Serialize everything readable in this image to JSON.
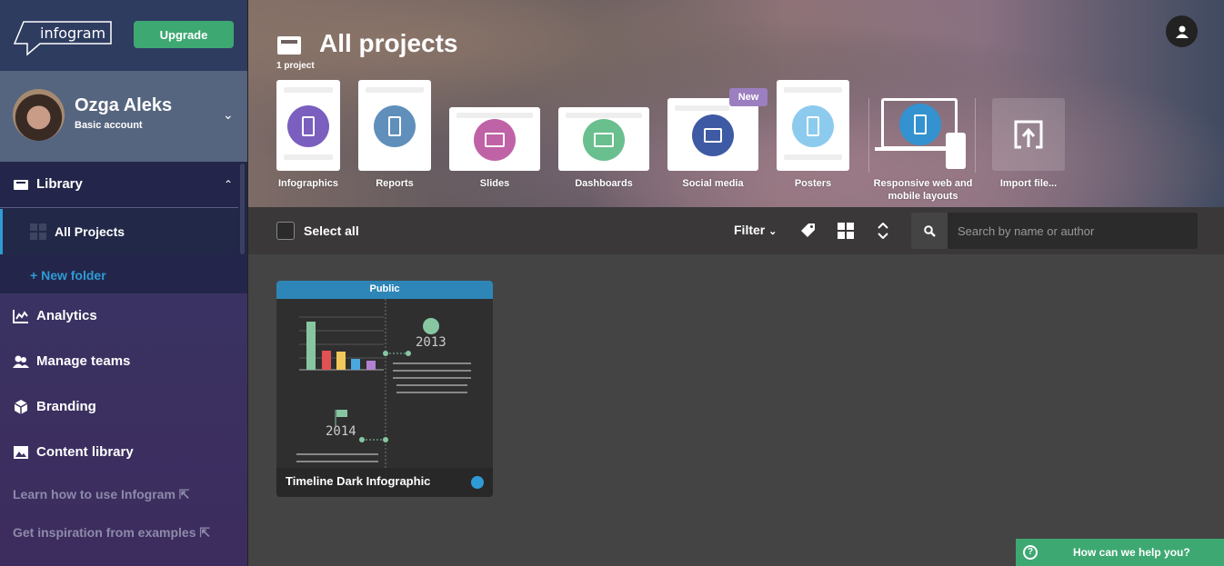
{
  "sidebar": {
    "logo_text": "infogram",
    "upgrade_label": "Upgrade",
    "user": {
      "name": "Ozga Aleks",
      "account": "Basic account"
    },
    "library_label": "Library",
    "all_projects_label": "All Projects",
    "new_folder_label": "New folder",
    "items": [
      {
        "label": "Analytics",
        "icon": "analytics-icon"
      },
      {
        "label": "Manage teams",
        "icon": "teams-icon"
      },
      {
        "label": "Branding",
        "icon": "cube-icon"
      },
      {
        "label": "Content library",
        "icon": "image-icon"
      }
    ],
    "links": [
      {
        "label": "Learn how to use Infogram"
      },
      {
        "label": "Get inspiration from examples"
      }
    ]
  },
  "header": {
    "title": "All projects",
    "count": "1 project",
    "types": [
      {
        "label": "Infographics",
        "color": "#7a5fbf"
      },
      {
        "label": "Reports",
        "color": "#5f8fba"
      },
      {
        "label": "Slides",
        "color": "#c062a6"
      },
      {
        "label": "Dashboards",
        "color": "#6abf8e"
      },
      {
        "label": "Social media",
        "color": "#3f5aa4",
        "badge": "New"
      },
      {
        "label": "Posters",
        "color": "#8ccbee"
      },
      {
        "label": "Responsive web and mobile layouts",
        "color": "#3392cf"
      },
      {
        "label": "Import file..."
      }
    ],
    "badge_color": "#9b7fc0"
  },
  "toolbar": {
    "select_all": "Select all",
    "filter": "Filter",
    "search_placeholder": "Search by name or author"
  },
  "projects": [
    {
      "title": "Timeline Dark Infographic",
      "visibility": "Public",
      "years": [
        "2013",
        "2014"
      ]
    }
  ],
  "help": {
    "label": "How can we help you?"
  },
  "colors": {
    "accent": "#3ea872",
    "link": "#2e9bd6"
  }
}
